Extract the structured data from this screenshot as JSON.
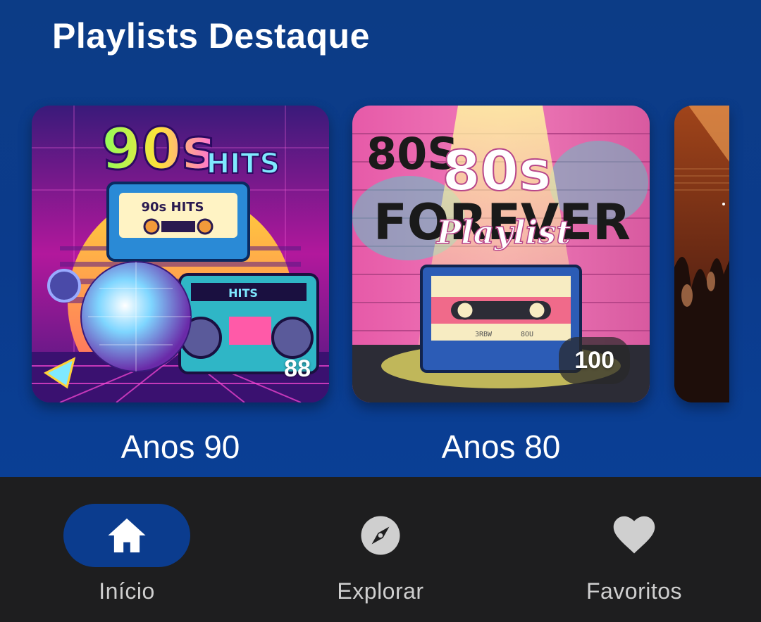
{
  "section": {
    "title": "Playlists Destaque"
  },
  "playlists": [
    {
      "title": "Anos 90",
      "count": "88",
      "art": {
        "main": "90s",
        "sub": "HITS",
        "tape_label": "90s HITS",
        "boombox_label": "HITS"
      }
    },
    {
      "title": "Anos 80",
      "count": "100",
      "art": {
        "graffiti_top": "80S",
        "graffiti_bottom": "FOREVER",
        "main": "80s",
        "sub": "Playlist",
        "tape_left": "3RBW",
        "tape_right": "8OU"
      }
    },
    {
      "title": "",
      "count": ""
    }
  ],
  "nav": {
    "items": [
      {
        "label": "Início",
        "icon": "home-icon",
        "active": true
      },
      {
        "label": "Explorar",
        "icon": "compass-icon",
        "active": false
      },
      {
        "label": "Favoritos",
        "icon": "heart-icon",
        "active": false
      }
    ]
  },
  "colors": {
    "background": "#0b3c8e",
    "nav_background": "#1e1e1f",
    "active_pill": "#0b3c8e",
    "nav_label": "#cfcfcf"
  }
}
